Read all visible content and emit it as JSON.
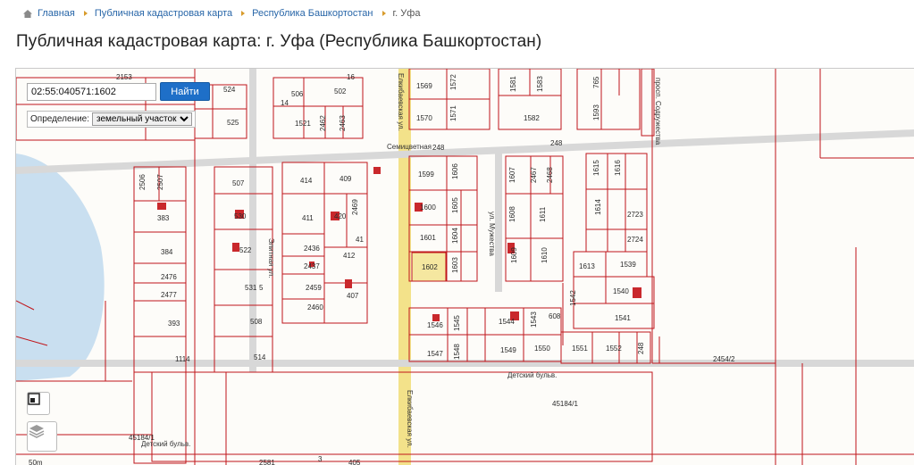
{
  "breadcrumb": {
    "items": [
      "Главная",
      "Публичная кадастровая карта",
      "Республика Башкортостан"
    ],
    "current": "г. Уфа"
  },
  "page_title": "Публичная кадастровая карта: г. Уфа (Республика Башкортостан)",
  "search": {
    "value": "02:55:040571:1602",
    "button": "Найти"
  },
  "definition": {
    "label": "Определение:",
    "selected": "земельный участок"
  },
  "icons": {
    "fullscreen": "fullscreen-icon",
    "layers": "layers-icon",
    "home": "home-icon"
  },
  "colors": {
    "parcel_border": "#c0151a",
    "selected_fill": "#f5e7a0",
    "road_yellow": "#f3e28a",
    "water": "#c9dff0",
    "link": "#2866a8",
    "button": "#1e6fc8"
  },
  "map": {
    "streets": [
      "Семицветная",
      "Элитная ул.",
      "Елкибаевская ул.",
      "ул. Мужества",
      "просп. Содружества",
      "Детский бульв.",
      "Детский бульв."
    ],
    "labels": [
      "2153",
      "524",
      "506",
      "502",
      "16",
      "14",
      "1521",
      "2462",
      "2463",
      "525",
      "394",
      "1569",
      "1572",
      "1581",
      "1583",
      "765",
      "1570",
      "1571",
      "1582",
      "1593",
      "248",
      "248",
      "2506",
      "2507",
      "507",
      "414",
      "409",
      "2469",
      "411",
      "420",
      "383",
      "530",
      "384",
      "522",
      "2436",
      "41",
      "412",
      "2437",
      "2476",
      "2459",
      "531",
      "407",
      "5",
      "2477",
      "2460",
      "393",
      "508",
      "1114",
      "514",
      "1599",
      "1606",
      "1600",
      "1605",
      "1601",
      "1604",
      "1602",
      "1603",
      "1607",
      "2467",
      "2468",
      "1608",
      "1611",
      "1609",
      "1610",
      "1615",
      "1616",
      "1614",
      "2723",
      "2724",
      "1613",
      "1539",
      "1540",
      "1542",
      "1541",
      "1546",
      "1545",
      "1544",
      "1543",
      "608",
      "1547",
      "1548",
      "1549",
      "1550",
      "1551",
      "1552",
      "248",
      "2454/2",
      "45184/1",
      "45184/1",
      "50m",
      "2581",
      "3",
      "405"
    ]
  }
}
